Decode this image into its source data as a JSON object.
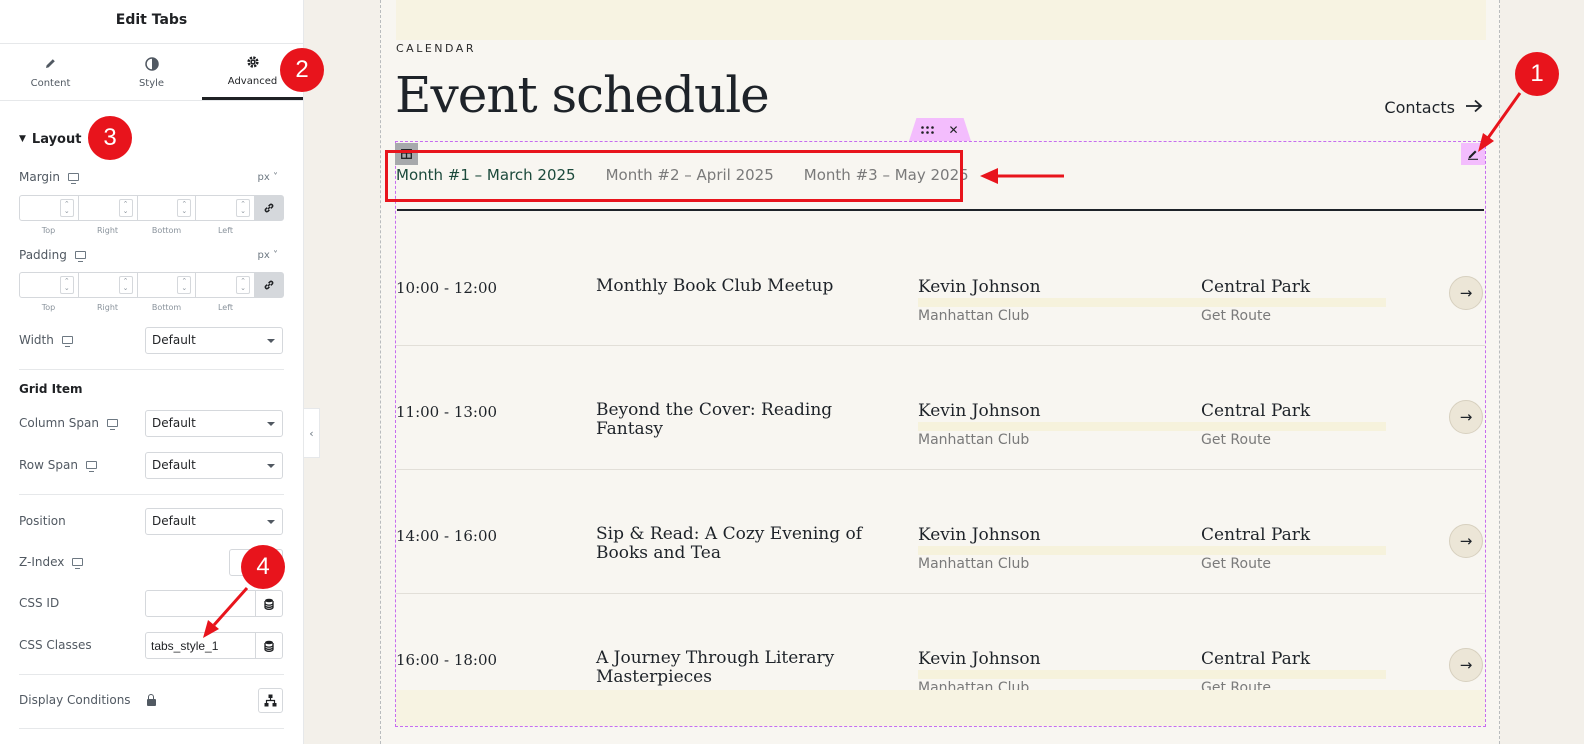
{
  "panel": {
    "title": "Edit Tabs",
    "tabs": [
      {
        "label": "Content",
        "icon": "pencil-icon"
      },
      {
        "label": "Style",
        "icon": "contrast-icon"
      },
      {
        "label": "Advanced",
        "icon": "gear-icon",
        "active": true
      }
    ],
    "layout": {
      "section_label": "Layout",
      "margin": {
        "label": "Margin",
        "unit": "px",
        "sides": [
          "Top",
          "Right",
          "Bottom",
          "Left"
        ]
      },
      "padding": {
        "label": "Padding",
        "unit": "px",
        "sides": [
          "Top",
          "Right",
          "Bottom",
          "Left"
        ]
      },
      "width": {
        "label": "Width",
        "value": "Default"
      }
    },
    "grid_item": {
      "heading": "Grid Item",
      "column_span": {
        "label": "Column Span",
        "value": "Default"
      },
      "row_span": {
        "label": "Row Span",
        "value": "Default"
      }
    },
    "position": {
      "label": "Position",
      "value": "Default"
    },
    "z_index": {
      "label": "Z-Index"
    },
    "css_id": {
      "label": "CSS ID",
      "value": ""
    },
    "css_classes": {
      "label": "CSS Classes",
      "value": "tabs_style_1"
    },
    "display_conditions": {
      "label": "Display Conditions"
    }
  },
  "page": {
    "eyebrow": "CALENDAR",
    "heading": "Event schedule",
    "contacts_label": "Contacts",
    "tabs": [
      {
        "label": "Month #1 – March 2025",
        "active": true
      },
      {
        "label": "Month #2 – April 2025",
        "active": false
      },
      {
        "label": "Month #3 – May 2025",
        "active": false
      }
    ],
    "events": [
      {
        "time": "10:00 - 12:00",
        "title": "Monthly Book Club Meetup",
        "host": "Kevin Johnson",
        "club": "Manhattan Club",
        "place": "Central Park",
        "route": "Get Route"
      },
      {
        "time": "11:00 - 13:00",
        "title": "Beyond the Cover: Reading Fantasy",
        "host": "Kevin Johnson",
        "club": "Manhattan Club",
        "place": "Central Park",
        "route": "Get Route"
      },
      {
        "time": "14:00 - 16:00",
        "title": "Sip & Read: A Cozy Evening of Books and Tea",
        "host": "Kevin Johnson",
        "club": "Manhattan Club",
        "place": "Central Park",
        "route": "Get Route"
      },
      {
        "time": "16:00 - 18:00",
        "title": "A Journey Through Literary Masterpieces",
        "host": "Kevin Johnson",
        "club": "Manhattan Club",
        "place": "Central Park",
        "route": "Get Route"
      }
    ]
  },
  "annotations": {
    "badges": [
      "1",
      "2",
      "3",
      "4"
    ]
  },
  "colors": {
    "accent_red": "#e8141c",
    "widget_outline": "#c66df0",
    "handle_pink": "#f3bdfd",
    "active_tab": "#1c4a3c"
  }
}
